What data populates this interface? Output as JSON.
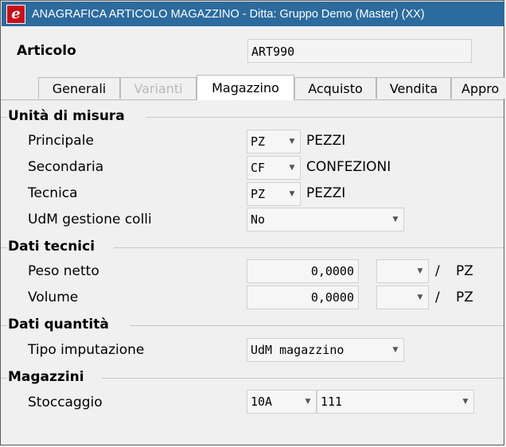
{
  "window": {
    "title": "ANAGRAFICA ARTICOLO MAGAZZINO - Ditta: Gruppo Demo (Master) (XX)",
    "icon": "e-logo-icon"
  },
  "header": {
    "article_label": "Articolo",
    "article_code": "ART990"
  },
  "tabs": [
    {
      "label": "Generali",
      "state": "normal"
    },
    {
      "label": "Varianti",
      "state": "disabled"
    },
    {
      "label": "Magazzino",
      "state": "active"
    },
    {
      "label": "Acquisto",
      "state": "normal"
    },
    {
      "label": "Vendita",
      "state": "normal"
    },
    {
      "label": "Appro",
      "state": "normal"
    }
  ],
  "sections": {
    "udm": {
      "title": "Unità di misura",
      "principale": {
        "label": "Principale",
        "code": "PZ",
        "desc": "PEZZI"
      },
      "secondaria": {
        "label": "Secondaria",
        "code": "CF",
        "desc": "CONFEZIONI"
      },
      "tecnica": {
        "label": "Tecnica",
        "code": "PZ",
        "desc": "PEZZI"
      },
      "colli": {
        "label": "UdM gestione colli",
        "value": "No"
      }
    },
    "tecnici": {
      "title": "Dati tecnici",
      "peso": {
        "label": "Peso netto",
        "value": "0,0000",
        "unit": "PZ"
      },
      "volume": {
        "label": "Volume",
        "value": "0,0000",
        "unit": "PZ"
      },
      "slash": "/"
    },
    "quantita": {
      "title": "Dati quantità",
      "imputazione": {
        "label": "Tipo imputazione",
        "value": "UdM magazzino"
      }
    },
    "magazzini": {
      "title": "Magazzini",
      "stoccaggio": {
        "label": "Stoccaggio",
        "code": "10A",
        "value": "111"
      }
    }
  },
  "colors": {
    "titlebar": "#2c6b9e",
    "icon": "#c8101a"
  }
}
